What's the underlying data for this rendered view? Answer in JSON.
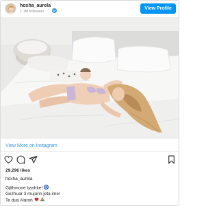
{
  "header": {
    "username": "hoxha_aurela",
    "followers": "1.1M followers",
    "view_profile_label": "View Profile"
  },
  "post": {
    "view_more_label": "View More on Instagram",
    "likes": "29,296 likes",
    "caption_username": "hoxha_aurela",
    "caption_lines": [
      "Gjithmone bashke!",
      "Gezhuar 3 mujorin jeta ime!",
      "Te dua Alaron"
    ]
  },
  "icons": {
    "verified": "verified-badge-icon",
    "like": "heart-outline-icon",
    "comment": "comment-bubble-icon",
    "share": "paper-plane-icon",
    "save": "bookmark-icon",
    "evil_eye": "nazar-evil-eye-icon",
    "heart_emoji": "red-heart-icon",
    "baby_emoji": "baby-icon"
  },
  "colors": {
    "accent": "#0095f6",
    "link": "#3897f0",
    "text": "#262626",
    "muted": "#8e8e8e",
    "border": "#dbdbdb",
    "heart_red": "#d8232a"
  }
}
